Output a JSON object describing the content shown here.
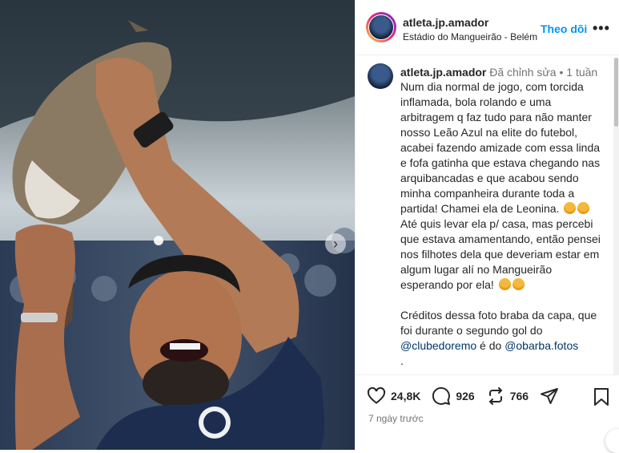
{
  "post": {
    "username": "atleta.jp.amador",
    "location": "Estádio do Mangueirão - Belém",
    "follow_label": "Theo dõi",
    "more_label": "•••"
  },
  "caption": {
    "username": "atleta.jp.amador",
    "edited": "Đã chỉnh sửa",
    "age": "1 tuần",
    "text_part1": "Num dia normal de jogo, com torcida inflamada, bola rolando e uma arbitragem q faz tudo para não manter nosso Leão Azul na elite do futebol, acabei fazendo amizade com essa linda e fofa gatinha que estava chegando nas arquibancadas e que acabou sendo minha companheira durante toda a partida! Chamei ela de Leonina.",
    "text_part2": "Até quis levar ela p/ casa, mas percebi que estava amamentando, então pensei nos filhotes dela que deveriam estar em algum lugar alí no Mangueirão esperando por ela!",
    "text_part3": "Créditos dessa foto braba da capa, que foi durante o segundo gol do",
    "mention1": "@clubedoremo",
    "text_part4": "é do",
    "mention2": "@obarba.fotos",
    "dot1": ".",
    "dot2": "."
  },
  "actions": {
    "likes": "24,8K",
    "comments": "926",
    "reposts": "766"
  },
  "timestamp": "7 ngày trước",
  "icons": [
    "heart-icon",
    "comment-icon",
    "repost-icon",
    "share-icon",
    "bookmark-icon",
    "chevron-right-icon"
  ],
  "colors": {
    "accent": "#0095f6",
    "mention": "#00376b",
    "muted": "#737373"
  }
}
